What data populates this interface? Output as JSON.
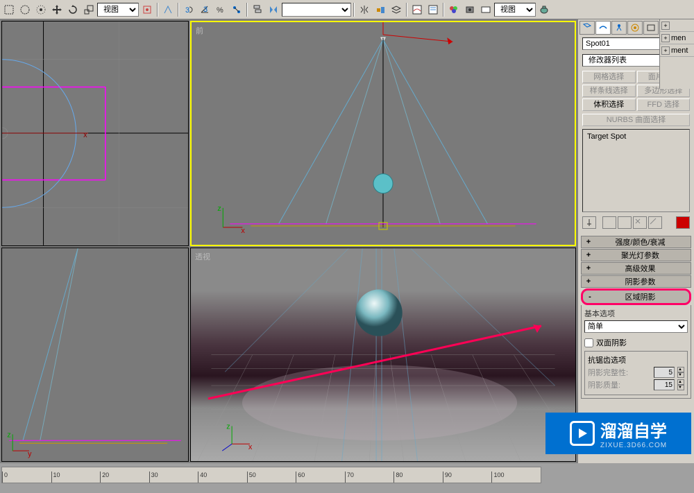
{
  "toolbar": {
    "view_dropdown": "视图",
    "view_dropdown2": "视图"
  },
  "viewports": {
    "top_left": {
      "label": ""
    },
    "front": {
      "label": "前"
    },
    "perspective": {
      "label": "透视"
    },
    "left": {
      "label": ""
    }
  },
  "cmd_panel": {
    "object_name": "Spot01",
    "modifier_list": "修改器列表",
    "buttons": {
      "mesh_select": "网格选择",
      "patch_select": "面片选择",
      "spline_select": "样条线选择",
      "poly_select": "多边形选择",
      "vol_select": "体积选择",
      "ffd_select": "FFD 选择",
      "nurbs_select": "NURBS 曲面选择"
    },
    "stack_item": "Target Spot"
  },
  "rollouts": {
    "intensity": {
      "title": "强度/颜色/衰减",
      "toggle": "+"
    },
    "spotlight": {
      "title": "聚光灯参数",
      "toggle": "+"
    },
    "advanced": {
      "title": "高级效果",
      "toggle": "+"
    },
    "shadow_params": {
      "title": "阴影参数",
      "toggle": "+"
    },
    "area_shadow": {
      "title": "区域阴影",
      "toggle": "-"
    },
    "basic_options": "基本选项",
    "mode": "简单",
    "two_sided": "双面阴影",
    "antialias_group": "抗锯齿选项",
    "integrity_label": "阴影完整性:",
    "integrity_val": "5",
    "quality_label": "阴影质量:",
    "quality_val": "15"
  },
  "extra_panel": {
    "row1": "",
    "row2": "men",
    "row3": "ment"
  },
  "ruler": {
    "ticks": [
      "0",
      "10",
      "20",
      "30",
      "40",
      "50",
      "60",
      "70",
      "80",
      "90",
      "100"
    ]
  },
  "watermark": {
    "title": "溜溜自学",
    "sub": "ZIXUE.3D66.COM"
  }
}
